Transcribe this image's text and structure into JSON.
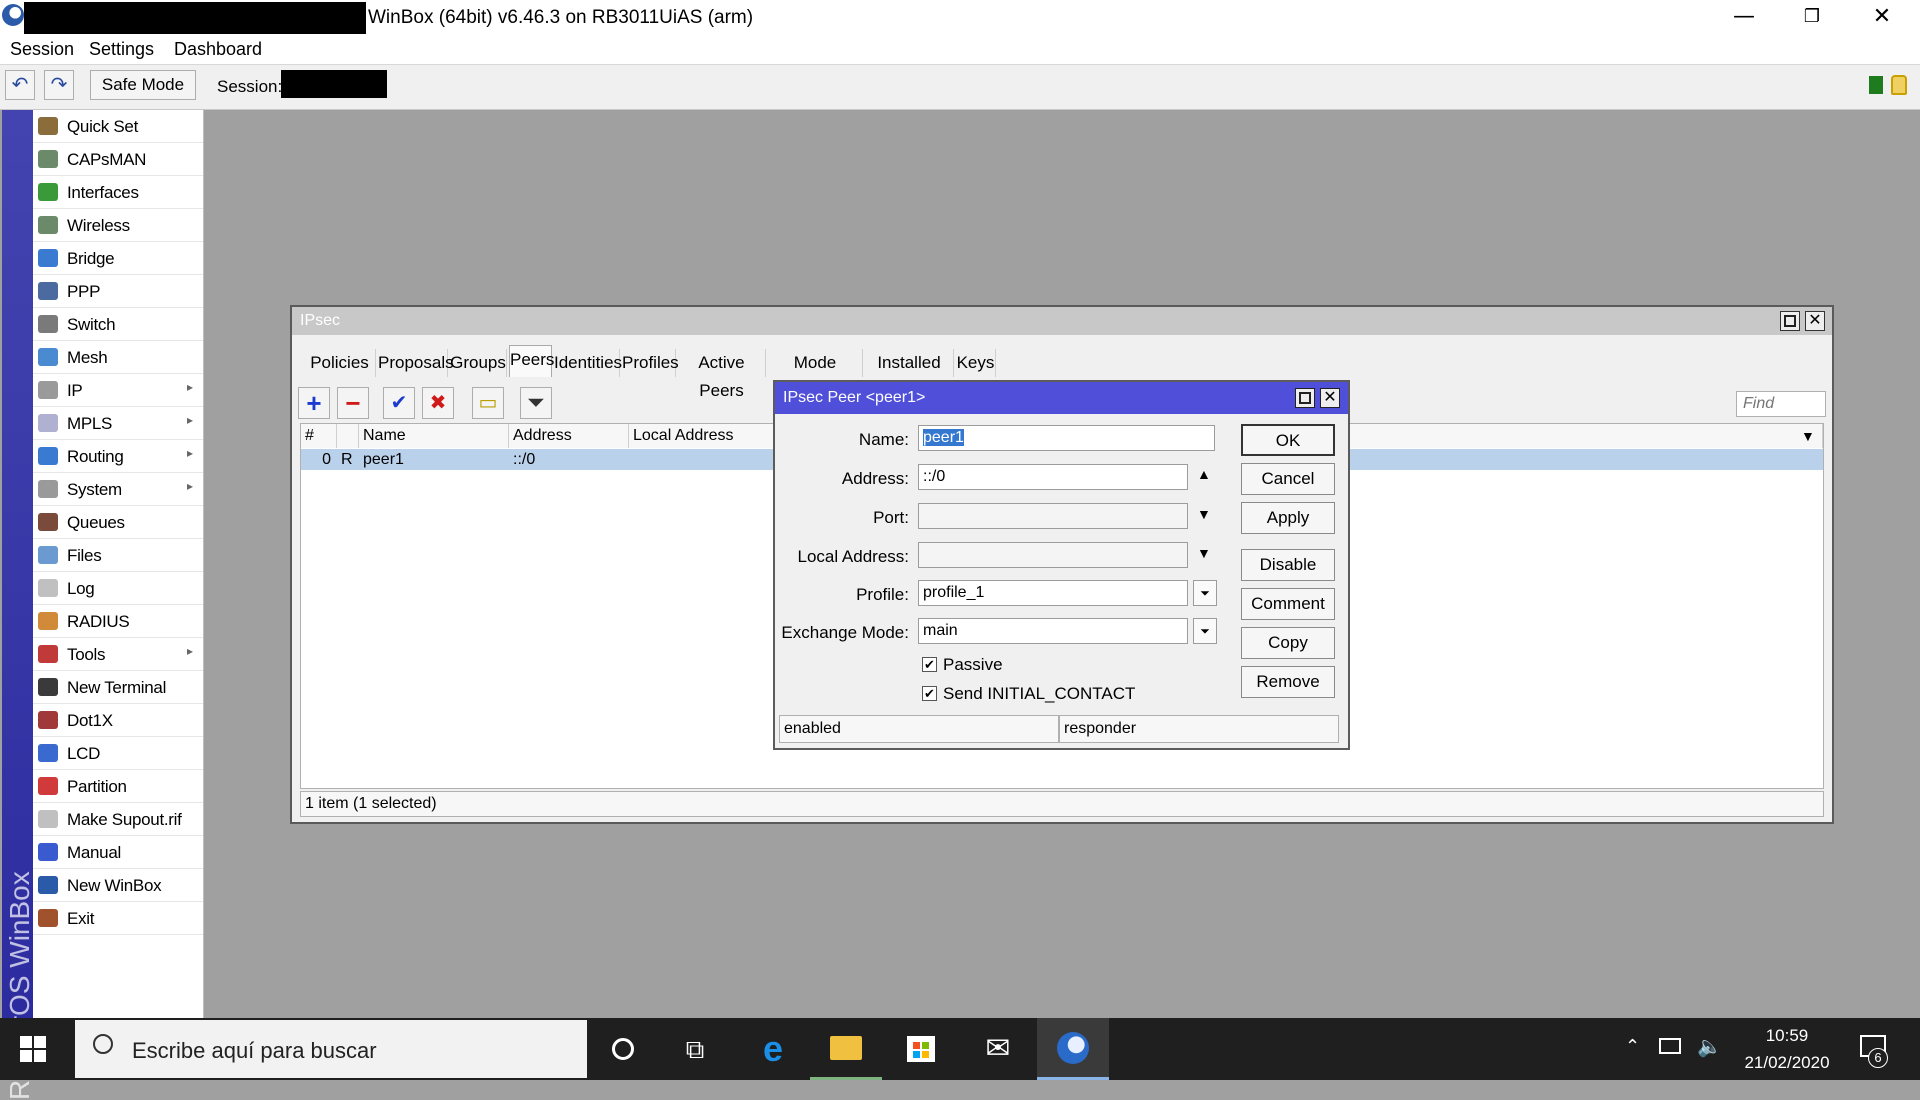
{
  "window": {
    "title": "WinBox (64bit) v6.46.3 on RB3011UiAS (arm)",
    "controls": {
      "minimize": "—",
      "restore": "❐",
      "close": "✕"
    }
  },
  "menu": [
    "Session",
    "Settings",
    "Dashboard"
  ],
  "toolbar": {
    "undo": "↶",
    "redo": "↷",
    "safe_mode": "Safe Mode",
    "session_label": "Session:"
  },
  "side_brand": "RouterOS WinBox",
  "sidebar": [
    {
      "label": "Quick Set",
      "color": "#8a6d3b",
      "arrow": false
    },
    {
      "label": "CAPsMAN",
      "color": "#6a8a6a",
      "arrow": false
    },
    {
      "label": "Interfaces",
      "color": "#3a9a3a",
      "arrow": false
    },
    {
      "label": "Wireless",
      "color": "#6a8a6a",
      "arrow": false
    },
    {
      "label": "Bridge",
      "color": "#3a7ad0",
      "arrow": false
    },
    {
      "label": "PPP",
      "color": "#4a6aa0",
      "arrow": false
    },
    {
      "label": "Switch",
      "color": "#7a7a7a",
      "arrow": false
    },
    {
      "label": "Mesh",
      "color": "#4a8ad0",
      "arrow": false
    },
    {
      "label": "IP",
      "color": "#9a9a9a",
      "arrow": true
    },
    {
      "label": "MPLS",
      "color": "#b0b0d0",
      "arrow": true
    },
    {
      "label": "Routing",
      "color": "#3a7ad0",
      "arrow": true
    },
    {
      "label": "System",
      "color": "#9a9a9a",
      "arrow": true
    },
    {
      "label": "Queues",
      "color": "#7a4a3a",
      "arrow": false
    },
    {
      "label": "Files",
      "color": "#6a9ad0",
      "arrow": false
    },
    {
      "label": "Log",
      "color": "#c0c0c0",
      "arrow": false
    },
    {
      "label": "RADIUS",
      "color": "#d08a3a",
      "arrow": false
    },
    {
      "label": "Tools",
      "color": "#c03a3a",
      "arrow": true
    },
    {
      "label": "New Terminal",
      "color": "#3a3a3a",
      "arrow": false
    },
    {
      "label": "Dot1X",
      "color": "#a03a3a",
      "arrow": false
    },
    {
      "label": "LCD",
      "color": "#3a6ad0",
      "arrow": false
    },
    {
      "label": "Partition",
      "color": "#d03a3a",
      "arrow": false
    },
    {
      "label": "Make Supout.rif",
      "color": "#c0c0c0",
      "arrow": false
    },
    {
      "label": "Manual",
      "color": "#3a5ad0",
      "arrow": false
    },
    {
      "label": "New WinBox",
      "color": "#2a5aa8",
      "arrow": false
    },
    {
      "label": "Exit",
      "color": "#a0522d",
      "arrow": false
    }
  ],
  "ipsec": {
    "title": "IPsec",
    "tabs": [
      "Policies",
      "Proposals",
      "Groups",
      "Peers",
      "Identities",
      "Profiles",
      "Active Peers",
      "Mode Configs",
      "Installed SAs",
      "Keys"
    ],
    "active_tab": "Peers",
    "icons": {
      "add": "+",
      "remove": "−",
      "enable": "✔",
      "disable": "✖",
      "comment": "▭",
      "filter": "⏷"
    },
    "find_placeholder": "Find",
    "columns": [
      "#",
      "Name",
      "Address",
      "Local Address"
    ],
    "rows": [
      {
        "num": "0",
        "flag": "R",
        "name": "peer1",
        "address": "::/0",
        "local_address": ""
      }
    ],
    "status": "1 item (1 selected)"
  },
  "dialog": {
    "title": "IPsec Peer <peer1>",
    "fields": {
      "name": {
        "label": "Name:",
        "value": "peer1"
      },
      "address": {
        "label": "Address:",
        "value": "::/0"
      },
      "port": {
        "label": "Port:",
        "value": ""
      },
      "local_address": {
        "label": "Local Address:",
        "value": ""
      },
      "profile": {
        "label": "Profile:",
        "value": "profile_1"
      },
      "exchange_mode": {
        "label": "Exchange Mode:",
        "value": "main"
      }
    },
    "checkboxes": {
      "passive": "Passive",
      "send_initial_contact": "Send INITIAL_CONTACT"
    },
    "buttons": {
      "ok": "OK",
      "cancel": "Cancel",
      "apply": "Apply",
      "disable": "Disable",
      "comment": "Comment",
      "copy": "Copy",
      "remove": "Remove"
    },
    "status_left": "enabled",
    "status_right": "responder"
  },
  "taskbar": {
    "search_placeholder": "Escribe aquí para buscar",
    "time": "10:59",
    "date": "21/02/2020",
    "notifications": "6"
  }
}
